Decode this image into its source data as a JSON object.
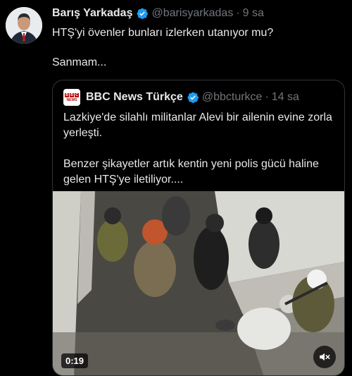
{
  "tweet": {
    "author_name": "Barış Yarkadaş",
    "author_handle": "@barisyarkadas",
    "time": "9 sa",
    "text_line1": "HTŞ'yi övenler bunları izlerken utanıyor mu?",
    "text_line2": "Sanmam..."
  },
  "quote": {
    "author_name": "BBC News Türkçe",
    "author_handle": "@bbcturkce",
    "time": "14 sa",
    "text_line1": "Lazkiye'de silahlı militanlar Alevi bir ailenin evine zorla yerleşti.",
    "text_line2": "Benzer şikayetler artık kentin yeni polis gücü haline gelen HTŞ'ye iletiliyor....",
    "video": {
      "duration": "0:19",
      "muted_icon": "speaker-muted-icon"
    }
  },
  "colors": {
    "verified": "#1d9bf0",
    "muted_text": "#71767b",
    "bbc_red": "#b80000",
    "border": "#2f3336"
  }
}
